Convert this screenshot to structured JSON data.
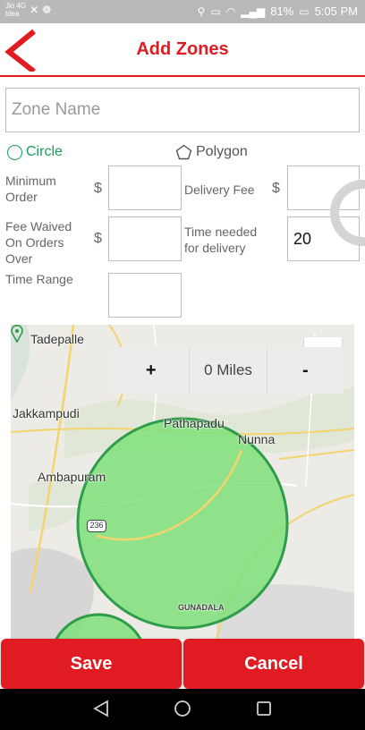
{
  "status_bar": {
    "carrier_line1": "Jio 4G",
    "carrier_line2": "Idea",
    "battery": "81%",
    "time": "5:05 PM"
  },
  "header": {
    "title": "Add Zones"
  },
  "form": {
    "zone_name_placeholder": "Zone Name",
    "zone_name_value": "",
    "shape_circle": "Circle",
    "shape_polygon": "Polygon",
    "selected_shape": "Circle",
    "min_order_label": "Minimum Order",
    "currency": "$",
    "min_order_value": "",
    "delivery_fee_label": "Delivery Fee",
    "delivery_fee_value": "",
    "fee_waived_label": "Fee Waived On Orders Over",
    "fee_waived_value": "",
    "time_needed_label": "Time needed for delivery",
    "time_needed_value": "20",
    "time_range_label": "Time Range",
    "time_range_value": ""
  },
  "map": {
    "places": [
      "Tadepalle",
      "Jakkampudi",
      "Pathapadu",
      "Nunna",
      "Ambapuram",
      "GUNADALA"
    ],
    "route_number": "236",
    "zone_fill": "#7fe07a",
    "zone_stroke": "#2e9c4a"
  },
  "radius_control": {
    "plus": "+",
    "value": "0 Miles",
    "minus": "-"
  },
  "actions": {
    "save": "Save",
    "cancel": "Cancel"
  },
  "colors": {
    "accent": "#e01b22",
    "selected": "#1d9e5a"
  }
}
